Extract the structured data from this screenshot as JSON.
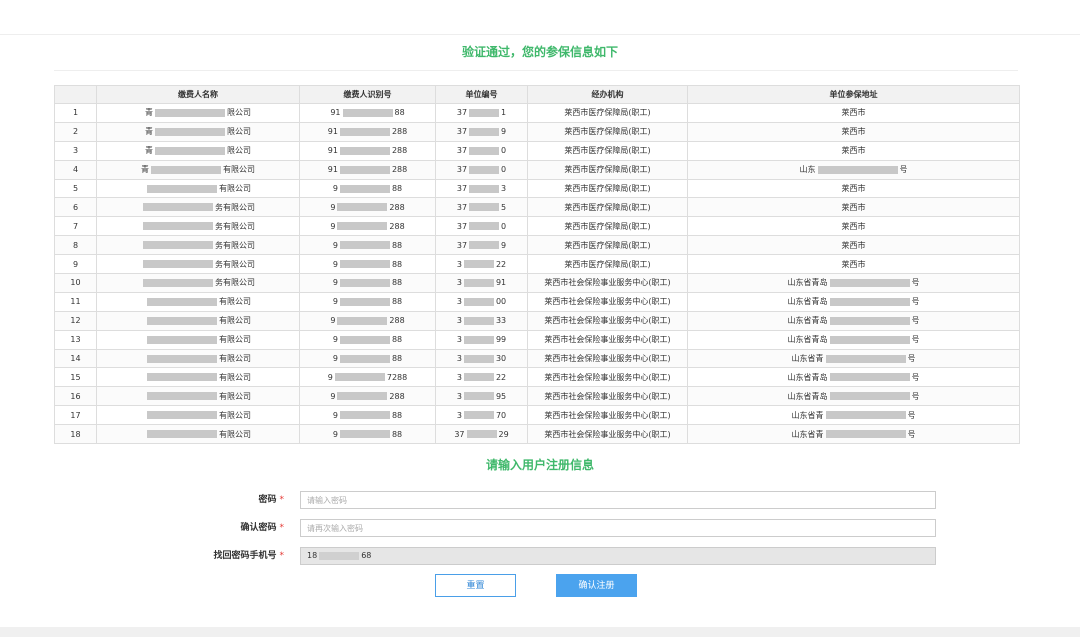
{
  "header": {
    "verify_title": "验证通过，您的参保信息如下"
  },
  "table": {
    "columns": [
      "",
      "缴费人名称",
      "缴费人识别号",
      "单位编号",
      "经办机构",
      "单位参保地址"
    ],
    "rows": [
      {
        "no": "1",
        "name_pre": "青",
        "name_suf": "限公司",
        "id_pre": "91",
        "id_suf": "88",
        "unit_pre": "37",
        "unit_suf": "1",
        "agency": "莱西市医疗保障局(职工)",
        "addr_pre": "",
        "addr_suf": "莱西市"
      },
      {
        "no": "2",
        "name_pre": "青",
        "name_suf": "限公司",
        "id_pre": "91",
        "id_suf": "288",
        "unit_pre": "37",
        "unit_suf": "9",
        "agency": "莱西市医疗保障局(职工)",
        "addr_pre": "",
        "addr_suf": "莱西市"
      },
      {
        "no": "3",
        "name_pre": "青",
        "name_suf": "限公司",
        "id_pre": "91",
        "id_suf": "288",
        "unit_pre": "37",
        "unit_suf": "0",
        "agency": "莱西市医疗保障局(职工)",
        "addr_pre": "",
        "addr_suf": "莱西市"
      },
      {
        "no": "4",
        "name_pre": "青",
        "name_suf": "有限公司",
        "id_pre": "91",
        "id_suf": "288",
        "unit_pre": "37",
        "unit_suf": "0",
        "agency": "莱西市医疗保障局(职工)",
        "addr_pre": "山东",
        "addr_suf": "号"
      },
      {
        "no": "5",
        "name_pre": "",
        "name_suf": "有限公司",
        "id_pre": "9",
        "id_suf": "88",
        "unit_pre": "37",
        "unit_suf": "3",
        "agency": "莱西市医疗保障局(职工)",
        "addr_pre": "",
        "addr_suf": "莱西市"
      },
      {
        "no": "6",
        "name_pre": "",
        "name_suf": "务有限公司",
        "id_pre": "9",
        "id_suf": "288",
        "unit_pre": "37",
        "unit_suf": "5",
        "agency": "莱西市医疗保障局(职工)",
        "addr_pre": "",
        "addr_suf": "莱西市"
      },
      {
        "no": "7",
        "name_pre": "",
        "name_suf": "务有限公司",
        "id_pre": "9",
        "id_suf": "288",
        "unit_pre": "37",
        "unit_suf": "0",
        "agency": "莱西市医疗保障局(职工)",
        "addr_pre": "",
        "addr_suf": "莱西市"
      },
      {
        "no": "8",
        "name_pre": "",
        "name_suf": "务有限公司",
        "id_pre": "9",
        "id_suf": "88",
        "unit_pre": "37",
        "unit_suf": "9",
        "agency": "莱西市医疗保障局(职工)",
        "addr_pre": "",
        "addr_suf": "莱西市"
      },
      {
        "no": "9",
        "name_pre": "",
        "name_suf": "务有限公司",
        "id_pre": "9",
        "id_suf": "88",
        "unit_pre": "3",
        "unit_suf": "22",
        "agency": "莱西市医疗保障局(职工)",
        "addr_pre": "",
        "addr_suf": "莱西市"
      },
      {
        "no": "10",
        "name_pre": "",
        "name_suf": "务有限公司",
        "id_pre": "9",
        "id_suf": "88",
        "unit_pre": "3",
        "unit_suf": "91",
        "agency": "莱西市社会保险事业服务中心(职工)",
        "addr_pre": "山东省青岛",
        "addr_suf": "号"
      },
      {
        "no": "11",
        "name_pre": "",
        "name_suf": "有限公司",
        "id_pre": "9",
        "id_suf": "88",
        "unit_pre": "3",
        "unit_suf": "00",
        "agency": "莱西市社会保险事业服务中心(职工)",
        "addr_pre": "山东省青岛",
        "addr_suf": "号"
      },
      {
        "no": "12",
        "name_pre": "",
        "name_suf": "有限公司",
        "id_pre": "9",
        "id_suf": "288",
        "unit_pre": "3",
        "unit_suf": "33",
        "agency": "莱西市社会保险事业服务中心(职工)",
        "addr_pre": "山东省青岛",
        "addr_suf": "号"
      },
      {
        "no": "13",
        "name_pre": "",
        "name_suf": "有限公司",
        "id_pre": "9",
        "id_suf": "88",
        "unit_pre": "3",
        "unit_suf": "99",
        "agency": "莱西市社会保险事业服务中心(职工)",
        "addr_pre": "山东省青岛",
        "addr_suf": "号"
      },
      {
        "no": "14",
        "name_pre": "",
        "name_suf": "有限公司",
        "id_pre": "9",
        "id_suf": "88",
        "unit_pre": "3",
        "unit_suf": "30",
        "agency": "莱西市社会保险事业服务中心(职工)",
        "addr_pre": "山东省青",
        "addr_suf": "号"
      },
      {
        "no": "15",
        "name_pre": "",
        "name_suf": "有限公司",
        "id_pre": "9",
        "id_suf": "7288",
        "unit_pre": "3",
        "unit_suf": "22",
        "agency": "莱西市社会保险事业服务中心(职工)",
        "addr_pre": "山东省青岛",
        "addr_suf": "号"
      },
      {
        "no": "16",
        "name_pre": "",
        "name_suf": "有限公司",
        "id_pre": "9",
        "id_suf": "288",
        "unit_pre": "3",
        "unit_suf": "95",
        "agency": "莱西市社会保险事业服务中心(职工)",
        "addr_pre": "山东省青岛",
        "addr_suf": "号"
      },
      {
        "no": "17",
        "name_pre": "",
        "name_suf": "有限公司",
        "id_pre": "9",
        "id_suf": "88",
        "unit_pre": "3",
        "unit_suf": "70",
        "agency": "莱西市社会保险事业服务中心(职工)",
        "addr_pre": "山东省青",
        "addr_suf": "号"
      },
      {
        "no": "18",
        "name_pre": "",
        "name_suf": "有限公司",
        "id_pre": "9",
        "id_suf": "88",
        "unit_pre": "37",
        "unit_suf": "29",
        "agency": "莱西市社会保险事业服务中心(职工)",
        "addr_pre": "山东省青",
        "addr_suf": "号"
      }
    ]
  },
  "register": {
    "title": "请输入用户注册信息",
    "required_mark": "*",
    "password_label": "密码",
    "password_placeholder": "请输入密码",
    "confirm_label": "确认密码",
    "confirm_placeholder": "请再次输入密码",
    "phone_label": "找回密码手机号",
    "phone_pre": "18",
    "phone_suf": "68",
    "reset_label": "重置",
    "submit_label": "确认注册"
  },
  "colors": {
    "accent_green": "#3fb86b",
    "button_blue": "#4ba3ee",
    "required_red": "#e53935"
  }
}
